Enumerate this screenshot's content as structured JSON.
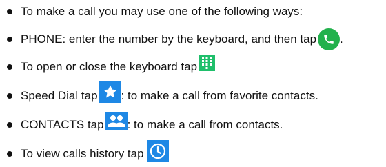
{
  "items": [
    {
      "text": "To make a call you may use one of the following ways:"
    },
    {
      "text": "PHONE: enter the number by the keyboard, and then tap",
      "after": ".",
      "icon": "phone-icon",
      "icon_color": "#22b14c"
    },
    {
      "text": "To open or close the keyboard tap",
      "icon": "keypad-icon",
      "icon_color": "#1fbf6b"
    },
    {
      "text": "Speed Dial tap",
      "after": ": to make a call from favorite contacts.",
      "icon": "star-icon",
      "icon_color": "#1e88e5"
    },
    {
      "text": "CONTACTS tap",
      "after": ": to make a call from contacts.",
      "icon": "contacts-icon",
      "icon_color": "#1e88e5"
    },
    {
      "text": "To view calls history tap",
      "icon": "clock-icon",
      "icon_color": "#1e88e5"
    }
  ]
}
